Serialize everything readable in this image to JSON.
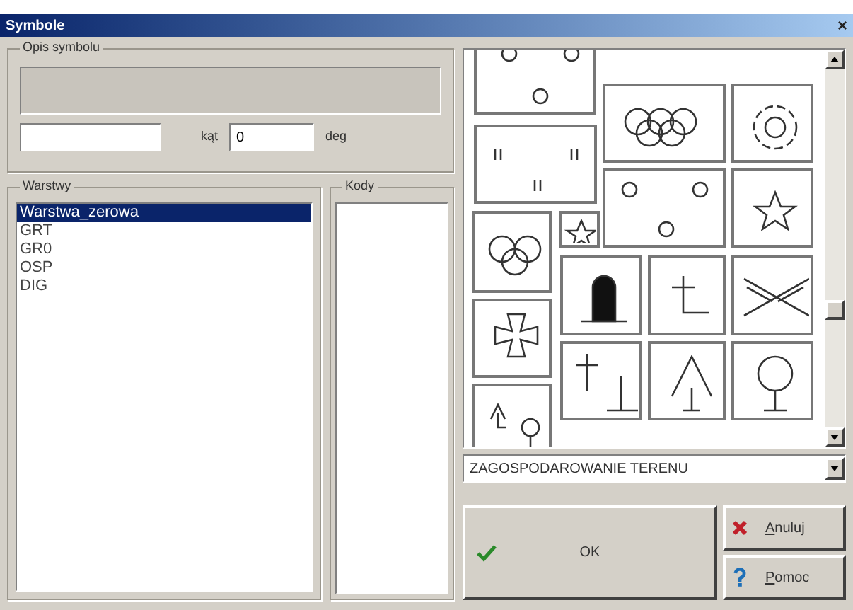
{
  "window": {
    "title": "Symbole",
    "close": "×"
  },
  "description": {
    "label": "Opis symbolu"
  },
  "angle": {
    "label": "kąt",
    "value": "0",
    "unit": "deg"
  },
  "layers": {
    "label": "Warstwy",
    "items": [
      {
        "label": "Warstwa_zerowa",
        "selected": true
      },
      {
        "label": "GRT",
        "selected": false
      },
      {
        "label": "GR0",
        "selected": false
      },
      {
        "label": "OSP",
        "selected": false
      },
      {
        "label": "DIG",
        "selected": false
      }
    ]
  },
  "codes": {
    "label": "Kody"
  },
  "category": {
    "value": "ZAGOSPODAROWANIE TERENU"
  },
  "buttons": {
    "ok": "OK",
    "cancel": "Anuluj",
    "help": "Pomoc"
  }
}
